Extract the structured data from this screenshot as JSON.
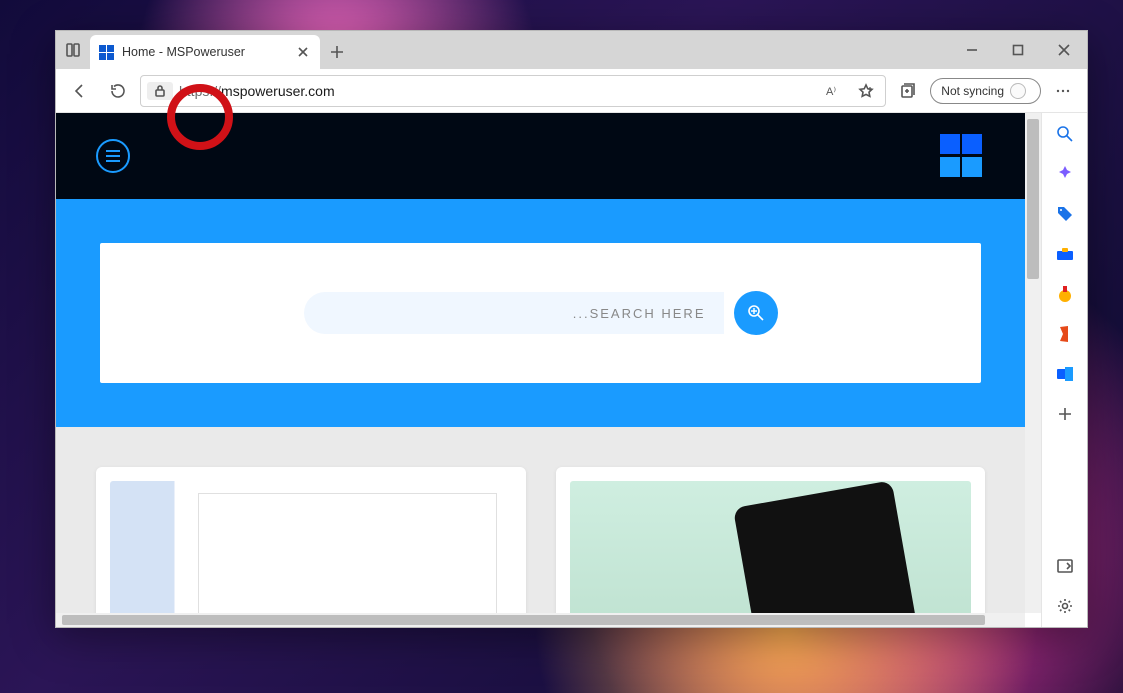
{
  "tab": {
    "title": "Home - MSPoweruser"
  },
  "address": {
    "scheme": "https://",
    "host": "mspoweruser.com",
    "full": "https://mspoweruser.com"
  },
  "sync": {
    "label": "Not syncing"
  },
  "page": {
    "search_placeholder": "...SEARCH HERE"
  },
  "sidebar": {
    "icons": [
      "search-icon",
      "ai-sparkle-icon",
      "shopping-tags-icon",
      "toolbox-icon",
      "games-icon",
      "office-icon",
      "outlook-icon"
    ]
  }
}
